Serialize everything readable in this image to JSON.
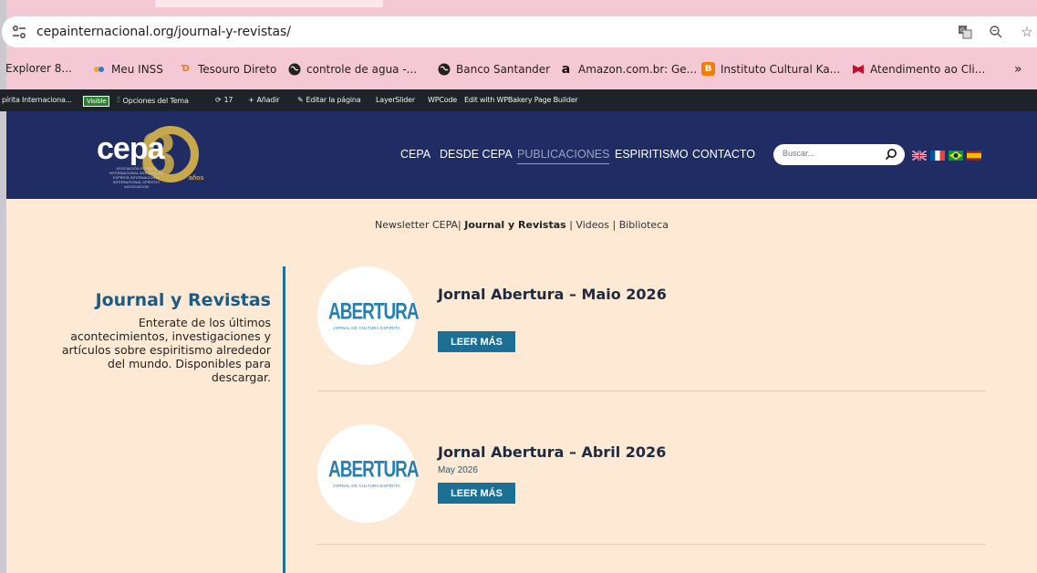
{
  "browser": {
    "url": "cepainternacional.org/journal-y-revistas/"
  },
  "bookmarks": [
    {
      "label": "Explorer 8...",
      "icon": "none"
    },
    {
      "label": "Meu INSS",
      "icon": "inss-icon"
    },
    {
      "label": "Tesouro Direto",
      "icon": "tesouro-icon"
    },
    {
      "label": "controle de agua -...",
      "icon": "globe-icon"
    },
    {
      "label": "Banco Santander",
      "icon": "globe-icon"
    },
    {
      "label": "Amazon.com.br: Ge...",
      "icon": "amazon-icon"
    },
    {
      "label": "Instituto Cultural Ka...",
      "icon": "blogger-icon"
    },
    {
      "label": "Atendimento ao Cli...",
      "icon": "mcafee-icon"
    },
    {
      "label": "»",
      "icon": "none"
    }
  ],
  "wpbar": {
    "site": "pírita Internaciona...",
    "visible": "Visible",
    "theme_options": "Opciones del Tema",
    "updates": "17",
    "add": "Añadir",
    "edit_page": "Editar la página",
    "layerslider": "LayerSlider",
    "wpcode": "WPCode",
    "wpbakery": "Edit with WPBakery Page Builder"
  },
  "logo": {
    "text": "cepa",
    "sub": "ASOCIACIÓN ESPÍRITA INTERNACIONAL ASSOCIAÇÃO ESPÍRITA INTERNACIONAL INTERNATIONAL SPIRITIST ASSOCIATION",
    "anos": "años"
  },
  "nav": {
    "items": [
      "CEPA",
      "DESDE CEPA",
      "PUBLICACIONES",
      "ESPIRITISMO",
      "CONTACTO"
    ]
  },
  "search": {
    "placeholder": "Buscar..."
  },
  "sub_nav": {
    "newsletter": "Newsletter CEPA|",
    "journal": "Journal y Revistas",
    "sep1": "|",
    "videos": "Videos",
    "sep2": "|",
    "biblioteca": "Biblioteca"
  },
  "sidebar": {
    "title": "Journal y Revistas",
    "description": "Enterate de los últimos acontecimientos, investigaciones y artículos sobre espiritismo alrededor del mundo. Disponibles para descargar."
  },
  "posts": [
    {
      "title": "Jornal Abertura – Maio 2026",
      "date": "",
      "button": "LEER MÁS",
      "thumb_title": "ABERTURA",
      "thumb_sub": "JORNAL DE CULTURA ESPÍRITA"
    },
    {
      "title": "Jornal Abertura – Abril 2026",
      "date": "May 2026",
      "button": "LEER MÁS",
      "thumb_title": "ABERTURA",
      "thumb_sub": "JORNAL DE CULTURA ESPÍRITA"
    }
  ],
  "colors": {
    "header_bg": "#202c64",
    "content_bg": "#fde9d4",
    "accent": "#1b6f95",
    "logo_gold": "#c8a84a"
  }
}
